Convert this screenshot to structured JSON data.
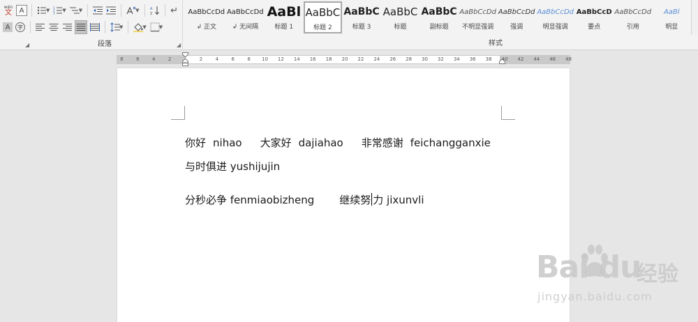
{
  "ribbon": {
    "paragraph_group_label": "段落",
    "styles_group_label": "样式",
    "pinyin_guide_label": "wén",
    "pinyin_guide_char": "文",
    "border_char_label": "A",
    "char_shading_label": "A",
    "enclose_char_label": "字",
    "styles": [
      {
        "preview": "AaBbCcDd",
        "label": "↲ 正文",
        "size": 10,
        "bold": false,
        "italic": false,
        "color": "#222222"
      },
      {
        "preview": "AaBbCcDd",
        "label": "↲ 无间隔",
        "size": 10,
        "bold": false,
        "italic": false,
        "color": "#222222"
      },
      {
        "preview": "AaBl",
        "label": "标题 1",
        "size": 19,
        "bold": true,
        "italic": false,
        "color": "#111111"
      },
      {
        "preview": "AaBbC",
        "label": "标题 2",
        "size": 15,
        "bold": false,
        "italic": false,
        "color": "#222222"
      },
      {
        "preview": "AaBbC",
        "label": "标题 3",
        "size": 14,
        "bold": true,
        "italic": false,
        "color": "#222222"
      },
      {
        "preview": "AaBbC",
        "label": "标题",
        "size": 15,
        "bold": false,
        "italic": false,
        "color": "#222222"
      },
      {
        "preview": "AaBbC",
        "label": "副标题",
        "size": 14,
        "bold": true,
        "italic": false,
        "color": "#222222"
      },
      {
        "preview": "AaBbCcDd",
        "label": "不明显强调",
        "size": 10,
        "bold": false,
        "italic": true,
        "color": "#555555"
      },
      {
        "preview": "AaBbCcDd",
        "label": "强调",
        "size": 10,
        "bold": false,
        "italic": true,
        "color": "#333333"
      },
      {
        "preview": "AaBbCcDd",
        "label": "明显强调",
        "size": 10,
        "bold": false,
        "italic": true,
        "color": "#5b8fd6"
      },
      {
        "preview": "AaBbCcD",
        "label": "要点",
        "size": 10,
        "bold": true,
        "italic": false,
        "color": "#222222"
      },
      {
        "preview": "AaBbCcDd",
        "label": "引用",
        "size": 10,
        "bold": false,
        "italic": true,
        "color": "#555555"
      },
      {
        "preview": "AaBl",
        "label": "明显",
        "size": 10,
        "bold": false,
        "italic": true,
        "color": "#5b8fd6"
      }
    ],
    "selected_style_index": 3
  },
  "ruler": {
    "left_numbers": [
      "8",
      "6",
      "4",
      "2"
    ],
    "right_numbers": [
      "2",
      "4",
      "6",
      "8",
      "10",
      "12",
      "14",
      "16",
      "18",
      "20",
      "22",
      "24",
      "26",
      "28",
      "30",
      "32",
      "34",
      "36",
      "38",
      "40",
      "42",
      "44",
      "46",
      "48"
    ]
  },
  "document": {
    "lines": [
      {
        "segments": [
          "你好",
          "nihao",
          "大家好",
          "dajiahao",
          "非常感谢",
          "feichangganxie"
        ]
      },
      {
        "segments": [
          "与时俱进 yushijujin"
        ]
      },
      {
        "segments": [
          "分秒必争 fenmiaobizheng",
          "继续努",
          "力 jixunvli"
        ]
      }
    ]
  },
  "watermark": {
    "brand": "Bai  du",
    "product": "经验",
    "url": "jingyan.baidu.com"
  },
  "colors": {
    "ribbon_bg": "#f3f3f3",
    "canvas_bg": "#e6e6e6",
    "page_bg": "#ffffff",
    "emphasis_blue": "#5b8fd6"
  }
}
